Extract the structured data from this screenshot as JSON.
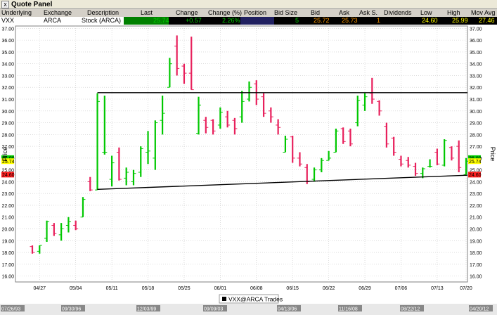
{
  "window": {
    "title": "Quote Panel",
    "close_glyph": "x"
  },
  "quote_header": [
    "Underlying",
    "Exchange",
    "Description",
    "Last",
    "Change",
    "Change (%)",
    "Position",
    "Bid Size",
    "Bid",
    "Ask",
    "Ask S.",
    "Dividends",
    "Low",
    "High",
    "Mov Avg"
  ],
  "quote_row": {
    "underlying": "VXX",
    "exchange": "ARCA",
    "description": "Stock (ARCA)",
    "last": "25.74",
    "change": "+0.57",
    "change_pct": "2.26%",
    "position": "",
    "bid_size": "5",
    "bid": "25.72",
    "ask": "25.73",
    "ask_size": "1",
    "dividends": "",
    "low": "24.60",
    "high": "25.99",
    "mov_avg": "27.46"
  },
  "chart_data": {
    "type": "ohlc",
    "ylabel": "Price",
    "ylim": [
      15.5,
      37.2
    ],
    "yticks": [
      "16.00",
      "17.00",
      "18.00",
      "19.00",
      "20.00",
      "21.00",
      "22.00",
      "23.00",
      "24.00",
      "25.00",
      "26.00",
      "27.00",
      "28.00",
      "29.00",
      "30.00",
      "31.00",
      "32.00",
      "33.00",
      "34.00",
      "35.00",
      "36.00",
      "37.00"
    ],
    "xticks": [
      "04/27",
      "05/04",
      "05/11",
      "05/18",
      "05/25",
      "06/01",
      "06/08",
      "06/15",
      "06/22",
      "06/29",
      "07/06",
      "07/13",
      "07/20"
    ],
    "last_labels": [
      {
        "text": "26.00",
        "color": "#00cc00"
      },
      {
        "text": "25.74",
        "color": "#ffff00"
      },
      {
        "text": "24.60",
        "color": "#ff2020"
      }
    ],
    "bars": [
      {
        "o": 18.5,
        "h": 18.6,
        "l": 17.9,
        "c": 18.0
      },
      {
        "o": 18.1,
        "h": 18.6,
        "l": 17.9,
        "c": 18.6
      },
      {
        "o": 19.2,
        "h": 20.7,
        "l": 18.9,
        "c": 20.6
      },
      {
        "o": 20.3,
        "h": 20.5,
        "l": 19.4,
        "c": 19.6
      },
      {
        "o": 19.5,
        "h": 20.5,
        "l": 19.0,
        "c": 20.0
      },
      {
        "o": 20.3,
        "h": 21.0,
        "l": 19.7,
        "c": 20.6
      },
      {
        "o": 20.3,
        "h": 20.7,
        "l": 19.9,
        "c": 20.0
      },
      {
        "o": 21.0,
        "h": 22.7,
        "l": 21.0,
        "c": 22.5
      },
      {
        "o": 24.0,
        "h": 24.4,
        "l": 23.2,
        "c": 23.3
      },
      {
        "o": 23.3,
        "h": 31.5,
        "l": 23.3,
        "c": 30.8
      },
      {
        "o": 26.5,
        "h": 31.3,
        "l": 26.3,
        "c": 26.5
      },
      {
        "o": 24.2,
        "h": 26.2,
        "l": 23.6,
        "c": 25.6
      },
      {
        "o": 26.5,
        "h": 26.9,
        "l": 24.1,
        "c": 24.2
      },
      {
        "o": 24.3,
        "h": 25.2,
        "l": 23.7,
        "c": 24.8
      },
      {
        "o": 24.0,
        "h": 25.0,
        "l": 23.7,
        "c": 24.7
      },
      {
        "o": 24.8,
        "h": 27.0,
        "l": 24.4,
        "c": 26.8
      },
      {
        "o": 26.5,
        "h": 28.3,
        "l": 25.5,
        "c": 26.6
      },
      {
        "o": 26.0,
        "h": 29.2,
        "l": 25.0,
        "c": 29.0
      },
      {
        "o": 29.2,
        "h": 31.3,
        "l": 28.0,
        "c": 29.8
      },
      {
        "o": 32.0,
        "h": 34.5,
        "l": 32.0,
        "c": 34.0
      },
      {
        "o": 35.5,
        "h": 36.4,
        "l": 33.0,
        "c": 33.6
      },
      {
        "o": 33.8,
        "h": 34.0,
        "l": 32.3,
        "c": 33.2
      },
      {
        "o": 33.2,
        "h": 36.3,
        "l": 31.8,
        "c": 31.8
      },
      {
        "o": 28.1,
        "h": 31.2,
        "l": 28.0,
        "c": 30.5
      },
      {
        "o": 29.2,
        "h": 29.5,
        "l": 28.1,
        "c": 28.6
      },
      {
        "o": 29.2,
        "h": 29.3,
        "l": 28.0,
        "c": 28.3
      },
      {
        "o": 28.8,
        "h": 30.3,
        "l": 28.5,
        "c": 29.9
      },
      {
        "o": 29.5,
        "h": 30.0,
        "l": 28.6,
        "c": 28.8
      },
      {
        "o": 29.2,
        "h": 29.4,
        "l": 28.0,
        "c": 28.5
      },
      {
        "o": 29.5,
        "h": 31.7,
        "l": 29.0,
        "c": 30.8
      },
      {
        "o": 31.0,
        "h": 32.5,
        "l": 30.8,
        "c": 32.0
      },
      {
        "o": 32.3,
        "h": 32.6,
        "l": 30.5,
        "c": 31.0
      },
      {
        "o": 31.2,
        "h": 31.5,
        "l": 29.5,
        "c": 29.8
      },
      {
        "o": 30.0,
        "h": 30.3,
        "l": 29.0,
        "c": 29.5
      },
      {
        "o": 28.8,
        "h": 29.3,
        "l": 28.0,
        "c": 28.6
      },
      {
        "o": 26.5,
        "h": 27.9,
        "l": 26.5,
        "c": 27.6
      },
      {
        "o": 27.8,
        "h": 27.9,
        "l": 25.6,
        "c": 26.0
      },
      {
        "o": 26.0,
        "h": 26.5,
        "l": 25.3,
        "c": 25.5
      },
      {
        "o": 25.2,
        "h": 25.5,
        "l": 23.8,
        "c": 24.0
      },
      {
        "o": 24.2,
        "h": 25.2,
        "l": 24.0,
        "c": 25.0
      },
      {
        "o": 25.0,
        "h": 26.0,
        "l": 24.8,
        "c": 25.8
      },
      {
        "o": 25.8,
        "h": 26.6,
        "l": 25.8,
        "c": 26.0
      },
      {
        "o": 26.5,
        "h": 28.5,
        "l": 26.5,
        "c": 28.3
      },
      {
        "o": 28.5,
        "h": 28.6,
        "l": 27.2,
        "c": 27.4
      },
      {
        "o": 28.3,
        "h": 28.5,
        "l": 27.0,
        "c": 27.2
      },
      {
        "o": 29.0,
        "h": 31.3,
        "l": 28.7,
        "c": 30.9
      },
      {
        "o": 30.5,
        "h": 31.5,
        "l": 30.0,
        "c": 31.2
      },
      {
        "o": 31.5,
        "h": 32.8,
        "l": 30.6,
        "c": 31.0
      },
      {
        "o": 30.8,
        "h": 30.9,
        "l": 29.6,
        "c": 30.0
      },
      {
        "o": 28.7,
        "h": 29.0,
        "l": 26.9,
        "c": 27.2
      },
      {
        "o": 27.7,
        "h": 27.8,
        "l": 26.2,
        "c": 26.5
      },
      {
        "o": 25.9,
        "h": 26.2,
        "l": 25.3,
        "c": 25.5
      },
      {
        "o": 25.8,
        "h": 26.1,
        "l": 25.2,
        "c": 25.4
      },
      {
        "o": 25.3,
        "h": 25.6,
        "l": 24.5,
        "c": 24.7
      },
      {
        "o": 24.7,
        "h": 25.2,
        "l": 24.3,
        "c": 25.1
      },
      {
        "o": 25.3,
        "h": 25.9,
        "l": 25.2,
        "c": 25.3
      },
      {
        "o": 26.5,
        "h": 26.8,
        "l": 25.4,
        "c": 25.5
      },
      {
        "o": 25.4,
        "h": 27.6,
        "l": 25.3,
        "c": 27.5
      },
      {
        "o": 26.9,
        "h": 27.0,
        "l": 25.8,
        "c": 26.0
      },
      {
        "o": 27.0,
        "h": 27.5,
        "l": 24.8,
        "c": 25.2
      },
      {
        "o": 24.6,
        "h": 26.0,
        "l": 24.6,
        "c": 25.74
      }
    ],
    "trendlines": [
      {
        "x1": 9,
        "y1": 31.55,
        "x2": 61,
        "y2": 31.55
      },
      {
        "x1": 9,
        "y1": 23.35,
        "x2": 61,
        "y2": 24.55
      }
    ],
    "legend": "VXX@ARCA Trades",
    "period_labels": [
      "07/26/93",
      "09/30/96",
      "12/03/99",
      "09/09/03",
      "04/13/06",
      "11/16/08",
      "08/22/12",
      "04/20/12"
    ]
  }
}
